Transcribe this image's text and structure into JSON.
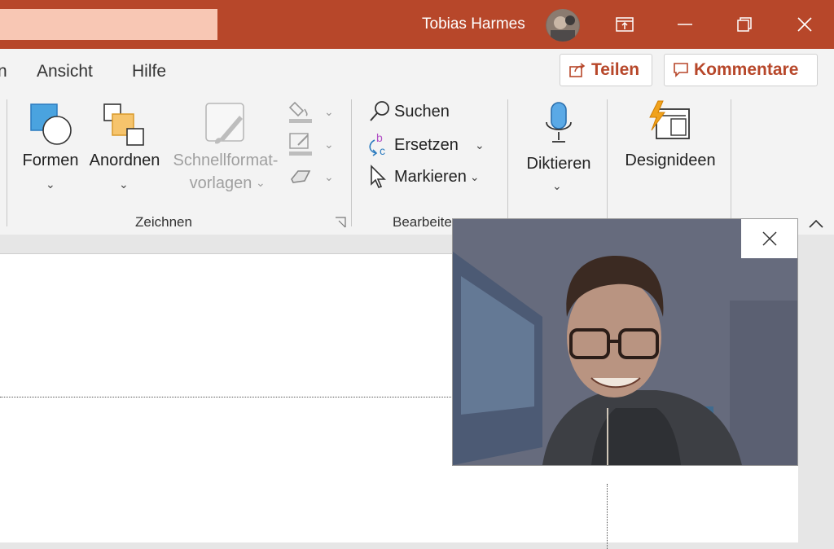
{
  "titlebar": {
    "user_name": "Tobias Harmes",
    "accent": "#b7472a"
  },
  "tabs": {
    "partial": "n",
    "ansicht": "Ansicht",
    "hilfe": "Hilfe"
  },
  "actions": {
    "share": "Teilen",
    "comments": "Kommentare"
  },
  "ribbon": {
    "shapes": "Formen",
    "arrange": "Anordnen",
    "quickstyles_line1": "Schnellformat-",
    "quickstyles_line2": "vorlagen",
    "drawing_group": "Zeichnen",
    "find": "Suchen",
    "replace": "Ersetzen",
    "select": "Markieren",
    "editing_group": "Bearbeiten",
    "dictate": "Diktieren",
    "design_ideas": "Designideen"
  },
  "icons": [
    "share-icon",
    "comment-icon",
    "shapes-icon",
    "arrange-icon",
    "quickstyles-icon",
    "fill-icon",
    "outline-icon",
    "effects-icon",
    "search-icon",
    "replace-icon",
    "cursor-icon",
    "microphone-icon",
    "design-ideas-icon",
    "close-icon",
    "minimize-icon",
    "restore-icon",
    "ribbon-display-icon",
    "collapse-icon",
    "dialog-launcher-icon"
  ]
}
